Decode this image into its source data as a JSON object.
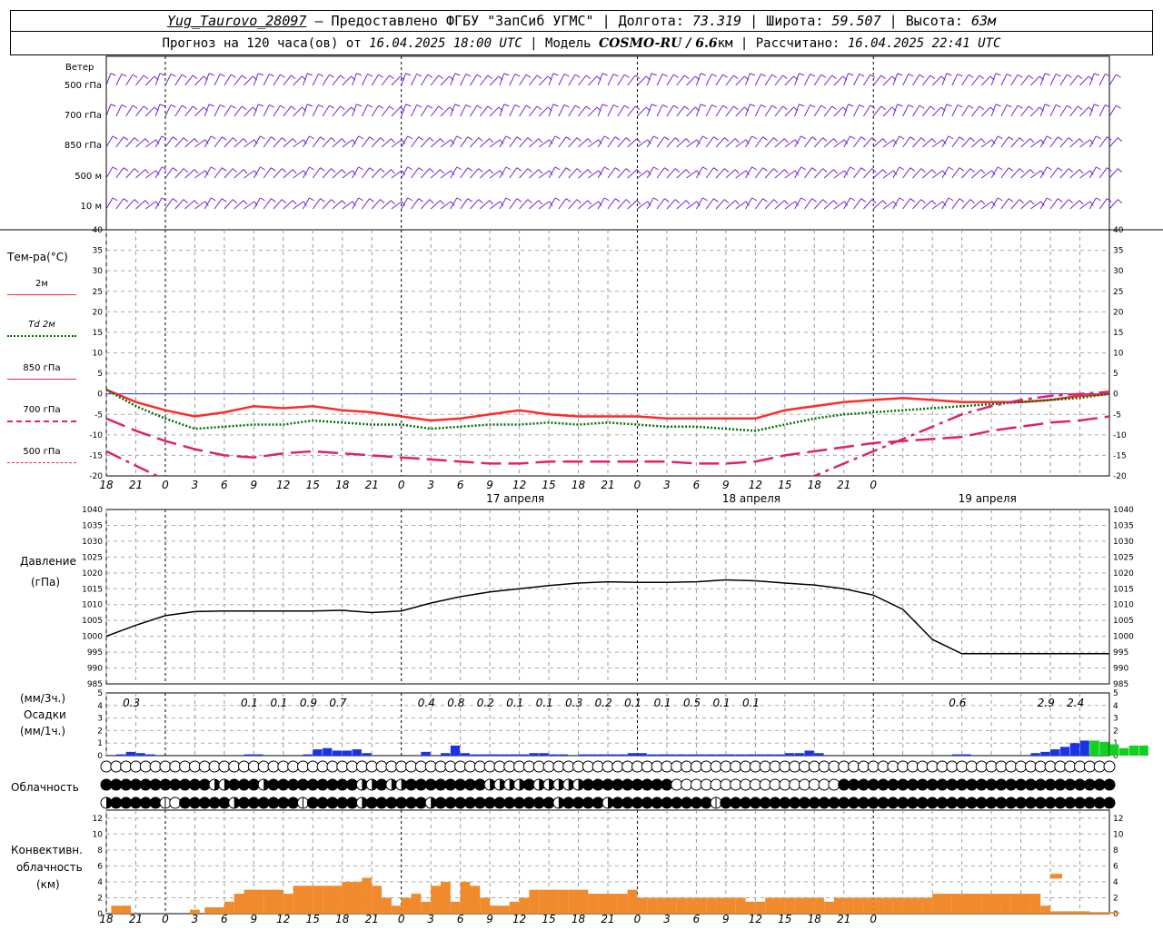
{
  "header": {
    "station": "Yug_Taurovo_28097",
    "provider": "– Предоставлено ФГБУ \"ЗапСиб УГМС\"",
    "lon_label": "| Долгота:",
    "lon": "73.319",
    "lat_label": "| Широта:",
    "lat": "59.507",
    "alt_label": "| Высота:",
    "alt": "63м",
    "forecast_label": "Прогноз на 120 часа(ов) от",
    "forecast_start": "16.04.2025 18:00 UTC",
    "model_label": "| Модель",
    "model": "COSMO-RU / 6.6",
    "model_unit": "км",
    "calc_label": "| Рассчитано:",
    "calc": "16.04.2025 22:41 UTC"
  },
  "wind_panel": {
    "title": "Ветер",
    "levels": [
      "500 гПа",
      "700 гПа",
      "850 гПа",
      "500 м",
      "10 м"
    ]
  },
  "temp_panel": {
    "title": "Тем-ра(°С)",
    "legend": [
      {
        "label": "2м",
        "color": "#ff2a2a"
      },
      {
        "label": "Td 2м",
        "color": "#007000"
      },
      {
        "label": "850 гПа",
        "color": "#e0206e"
      },
      {
        "label": "700 гПа",
        "color": "#e0206e"
      },
      {
        "label": "500 гПа",
        "color": "#e0206e"
      }
    ]
  },
  "pressure_panel": {
    "title": "Давление",
    "unit": "(гПа)"
  },
  "precip_panel": {
    "unit3": "(мм/3ч.)",
    "title": "Осадки",
    "unit1": "(мм/1ч.)"
  },
  "cloud_panel": {
    "title": "Облачность"
  },
  "conv_panel": {
    "title1": "Конвективн.",
    "title2": "облачность",
    "unit": "(км)"
  },
  "time_axis": {
    "hour_labels": [
      "18",
      "21",
      "0",
      "3",
      "6",
      "9",
      "12",
      "15",
      "18",
      "21",
      "0",
      "3",
      "6",
      "9",
      "12",
      "15",
      "18",
      "21",
      "0",
      "3",
      "6",
      "9",
      "12",
      "15",
      "18",
      "21",
      "0"
    ],
    "dates": [
      "17 апреля",
      "18 апреля",
      "19 апреля"
    ]
  },
  "chart_data": [
    {
      "type": "line",
      "panel": "temperature",
      "x_hours": [
        0,
        3,
        6,
        9,
        12,
        15,
        18,
        21,
        24,
        27,
        30,
        33,
        36,
        39,
        42,
        45,
        48,
        51,
        54,
        57,
        60,
        63,
        66,
        69,
        72,
        75,
        78,
        81,
        84,
        87,
        90,
        93,
        96,
        99,
        102
      ],
      "ylim": [
        -20,
        40
      ],
      "yticks": [
        -20,
        -15,
        -10,
        -5,
        0,
        5,
        10,
        15,
        20,
        25,
        30,
        35,
        40
      ],
      "series": [
        {
          "name": "2м",
          "color": "#ff2a2a",
          "values": [
            1,
            -2,
            -4,
            -5.5,
            -4.5,
            -3,
            -3.5,
            -3,
            -4,
            -4.5,
            -5.5,
            -6.5,
            -6,
            -5,
            -4,
            -5,
            -5.5,
            -5.5,
            -5.5,
            -6,
            -6,
            -6,
            -6,
            -4,
            -3,
            -2,
            -1.5,
            -1,
            -1.5,
            -2,
            -2,
            -2,
            -1.5,
            -0.5,
            0
          ]
        },
        {
          "name": "Td 2м",
          "color": "#007000",
          "values": [
            1,
            -3,
            -6,
            -8.5,
            -8,
            -7.5,
            -7.5,
            -6.5,
            -7,
            -7.5,
            -7.5,
            -8.5,
            -8,
            -7.5,
            -7.5,
            -7,
            -7.5,
            -7,
            -7.5,
            -8,
            -8,
            -8.5,
            -9,
            -7.5,
            -6,
            -5,
            -4.5,
            -4,
            -3.5,
            -3,
            -2.5,
            -2,
            -1.5,
            -1,
            0
          ]
        },
        {
          "name": "850 гПа",
          "color": "#e0206e",
          "values": [
            -6,
            -9,
            -11.5,
            -13.5,
            -15,
            -15.5,
            -14.5,
            -14,
            -14.5,
            -15,
            -15.5,
            -16,
            -16.5,
            -17,
            -17,
            -16.5,
            -16.5,
            -16.5,
            -16.5,
            -16.5,
            -17,
            -17,
            -16.5,
            -15,
            -14,
            -13,
            -12,
            -11.5,
            -11,
            -10.5,
            -9,
            -8,
            -7,
            -6.5,
            -5.5
          ]
        },
        {
          "name": "700 гПа",
          "color": "#e0206e",
          "values": [
            -14,
            -17.5,
            -21,
            -23,
            -25,
            -26,
            -26.5,
            -26,
            -26,
            -26.5,
            -27,
            -27,
            -27.5,
            -27.5,
            -27,
            -27,
            -26.5,
            -26,
            -26,
            -26,
            -25.5,
            -25,
            -24,
            -22,
            -20,
            -17,
            -14,
            -11,
            -8,
            -5,
            -3,
            -1.5,
            -0.5,
            0,
            0.5
          ]
        }
      ]
    },
    {
      "type": "line",
      "panel": "pressure",
      "x_hours": [
        0,
        3,
        6,
        9,
        12,
        15,
        18,
        21,
        24,
        27,
        30,
        33,
        36,
        39,
        42,
        45,
        48,
        51,
        54,
        57,
        60,
        63,
        66,
        69,
        72,
        75,
        78,
        81,
        84,
        87,
        90,
        93,
        96,
        99,
        102
      ],
      "ylim": [
        985,
        1040
      ],
      "yticks": [
        985,
        990,
        995,
        1000,
        1005,
        1010,
        1015,
        1020,
        1025,
        1030,
        1035,
        1040
      ],
      "series": [
        {
          "name": "pressure",
          "color": "#000000",
          "values": [
            1000,
            1003.5,
            1006.5,
            1007.8,
            1008,
            1008,
            1008,
            1008,
            1008.2,
            1007.5,
            1008,
            1010.5,
            1012.5,
            1014,
            1015,
            1016,
            1016.8,
            1017.2,
            1017,
            1017,
            1017.2,
            1017.8,
            1017.5,
            1016.8,
            1016.2,
            1015,
            1013,
            1008.5,
            999,
            994.5,
            994.5,
            994.5,
            994.5,
            994.5,
            994.5
          ]
        }
      ]
    },
    {
      "type": "bar",
      "panel": "precipitation",
      "ylim": [
        0,
        5
      ],
      "yticks": [
        0,
        1,
        2,
        3,
        4,
        5
      ],
      "three_hour_labels": [
        "0.3",
        "0.1",
        "0.1",
        "0.9",
        "0.7",
        "0.4",
        "0.8",
        "0.2",
        "0.1",
        "0.1",
        "0.3",
        "0.2",
        "0.1",
        "0.1",
        "0.5",
        "0.1",
        "0.1",
        "0.6",
        "2.9",
        "2.4"
      ],
      "hourly_values": [
        0,
        0.1,
        0.3,
        0.2,
        0.1,
        0,
        0,
        0,
        0,
        0,
        0,
        0,
        0,
        0,
        0.1,
        0.1,
        0,
        0,
        0,
        0,
        0.1,
        0.5,
        0.6,
        0.4,
        0.4,
        0.5,
        0.2,
        0,
        0,
        0,
        0,
        0,
        0.3,
        0,
        0.2,
        0.8,
        0.2,
        0.1,
        0.1,
        0.1,
        0.1,
        0.1,
        0.1,
        0.2,
        0.2,
        0.1,
        0.1,
        0,
        0.1,
        0.1,
        0.1,
        0.1,
        0.1,
        0.2,
        0.2,
        0.1,
        0.1,
        0.1,
        0.1,
        0.1,
        0.1,
        0.1,
        0.1,
        0.1,
        0.1,
        0.1,
        0.1,
        0.1,
        0.1,
        0.2,
        0.2,
        0.4,
        0.2,
        0,
        0,
        0,
        0,
        0,
        0,
        0,
        0,
        0,
        0,
        0,
        0,
        0,
        0.1,
        0.1,
        0,
        0,
        0,
        0,
        0,
        0,
        0.2,
        0.3,
        0.5,
        0.7,
        1,
        1.2,
        1.2,
        1.1,
        0.9,
        0.6,
        0.8,
        0.8
      ]
    },
    {
      "type": "bar",
      "panel": "convective_cloud",
      "ylim": [
        0,
        13
      ],
      "yticks": [
        0,
        2,
        4,
        6,
        8,
        10,
        12
      ],
      "color": "#f08a2c"
    }
  ]
}
